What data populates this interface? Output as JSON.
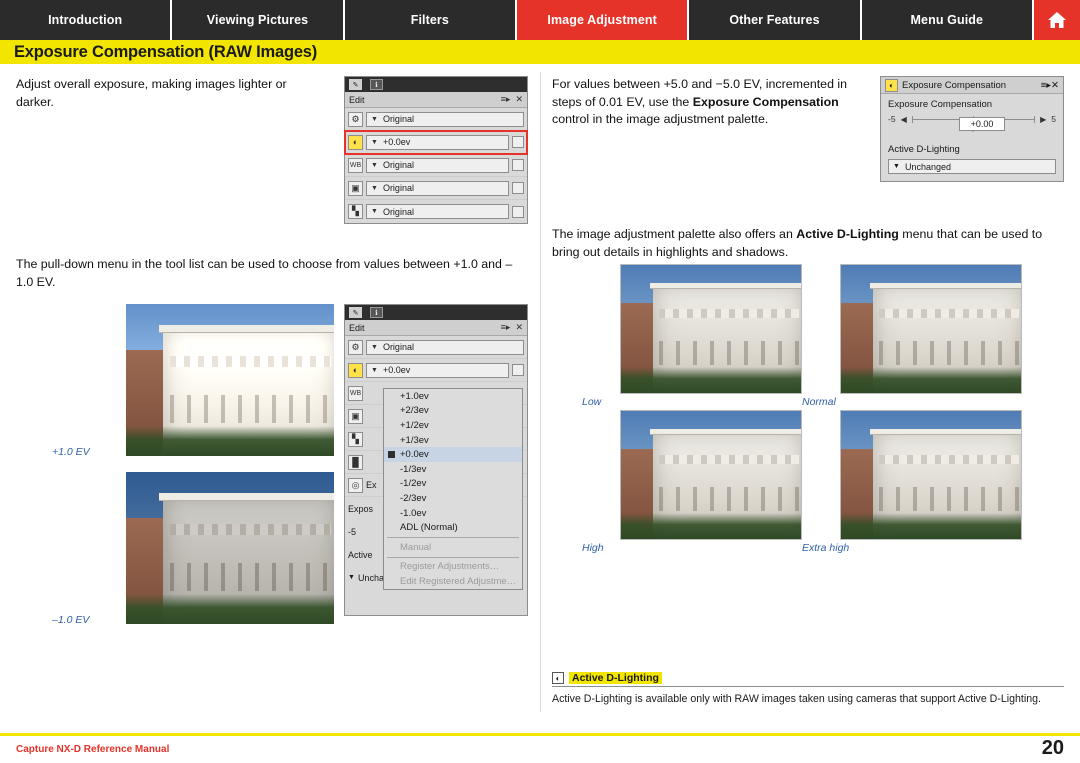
{
  "tabs": [
    {
      "label": "Introduction",
      "active": false
    },
    {
      "label": "Viewing Pictures",
      "active": false
    },
    {
      "label": "Filters",
      "active": false
    },
    {
      "label": "Image Adjustment",
      "active": true
    },
    {
      "label": "Other Features",
      "active": false
    },
    {
      "label": "Menu Guide",
      "active": false
    }
  ],
  "home_icon": "home-icon",
  "page_title": "Exposure Compensation (RAW Images)",
  "left": {
    "para1": "Adjust overall exposure, making images lighter or darker.",
    "para2": "The pull-down menu in the tool list can be used to choose from values between +1.0 and –1.0 EV.",
    "caption_plus": "+1.0 EV",
    "caption_minus": "–1.0 EV"
  },
  "right": {
    "para1_a": "For values between +5.0 and −5.0 EV, incremented in steps of 0.01 EV, use the ",
    "para1_b": "Exposure Compensation",
    "para1_c": " control in the image adjustment palette.",
    "para2_a": "The image adjustment palette also offers an ",
    "para2_b": "Active D-Lighting",
    "para2_c": " menu that can be used to bring out details in highlights and shadows.",
    "captions": [
      "Low",
      "Normal",
      "High",
      "Extra high"
    ]
  },
  "tool_panel_1": {
    "tabs": [
      "edit-tab-icon",
      "info-tab-icon"
    ],
    "head_label": "Edit",
    "head_icons": [
      "menu-icon",
      "close-icon"
    ],
    "rows": [
      {
        "icon": "gear-icon",
        "value": "Original",
        "checkbox": false,
        "highlight": false
      },
      {
        "icon": "exposure-icon",
        "value": "+0.0ev",
        "checkbox": true,
        "highlight": true
      },
      {
        "icon": "WB",
        "value": "Original",
        "checkbox": true,
        "highlight": false
      },
      {
        "icon": "picture-control-icon",
        "value": "Original",
        "checkbox": true,
        "highlight": false
      },
      {
        "icon": "levels-icon",
        "value": "Original",
        "checkbox": true,
        "highlight": false
      }
    ]
  },
  "tool_panel_2": {
    "tabs": [
      "edit-tab-icon",
      "info-tab-icon"
    ],
    "head_label": "Edit",
    "head_icons": [
      "menu-icon",
      "close-icon"
    ],
    "rows": [
      {
        "icon": "gear-icon",
        "value": "Original",
        "checkbox": false
      },
      {
        "icon": "exposure-icon",
        "value": "+0.0ev",
        "checkbox": true
      }
    ],
    "side_labels": [
      "WB",
      "picture-control-icon",
      "levels-icon",
      "noise-reduction-icon",
      "Ex",
      "Expos",
      "-5",
      "Active"
    ],
    "dropdown_items": [
      {
        "label": "+1.0ev",
        "checked": false,
        "disabled": false
      },
      {
        "label": "+2/3ev",
        "checked": false,
        "disabled": false
      },
      {
        "label": "+1/2ev",
        "checked": false,
        "disabled": false
      },
      {
        "label": "+1/3ev",
        "checked": false,
        "disabled": false
      },
      {
        "label": "+0.0ev",
        "checked": true,
        "disabled": false
      },
      {
        "label": "-1/3ev",
        "checked": false,
        "disabled": false
      },
      {
        "label": "-1/2ev",
        "checked": false,
        "disabled": false
      },
      {
        "label": "-2/3ev",
        "checked": false,
        "disabled": false
      },
      {
        "label": "-1.0ev",
        "checked": false,
        "disabled": false
      },
      {
        "label": "ADL (Normal)",
        "checked": false,
        "disabled": false
      },
      {
        "label": "Manual",
        "checked": false,
        "disabled": true
      },
      {
        "label": "Register Adjustments…",
        "checked": false,
        "disabled": true
      },
      {
        "label": "Edit Registered Adjustme…",
        "checked": false,
        "disabled": true
      }
    ],
    "bottom_value": "Unchanged"
  },
  "expo_panel": {
    "title": "Exposure Compensation",
    "title_icons": [
      "exposure-icon",
      "menu-icon",
      "close-icon"
    ],
    "section_label": "Exposure Compensation",
    "min": "-5",
    "max": "5",
    "value": "+0.00",
    "adl_label": "Active D-Lighting",
    "adl_value": "Unchanged"
  },
  "note": {
    "badge": "note-icon",
    "title": "Active D-Lighting",
    "body": "Active D-Lighting is available only with RAW images taken using cameras that support Active D-Lighting."
  },
  "footer": {
    "text": "Capture NX-D Reference Manual",
    "page": "20"
  },
  "colors": {
    "accent_red": "#e5332a",
    "accent_yellow": "#f2e600",
    "tab_dark": "#2b2b2b",
    "caption_blue": "#2f5fa8"
  }
}
